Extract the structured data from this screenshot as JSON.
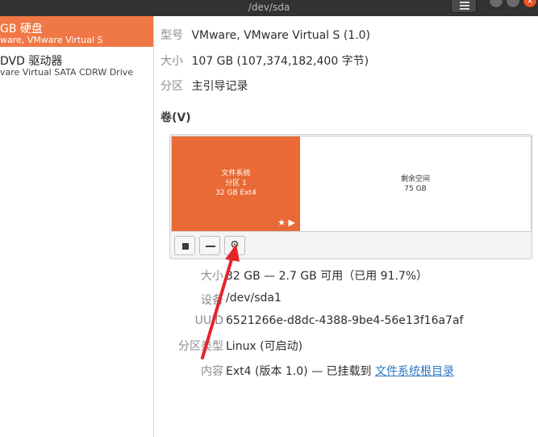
{
  "window": {
    "title": "/dev/sda",
    "menu_icon": "hamburger-menu-icon",
    "window_controls": [
      "minimize-icon",
      "maximize-icon",
      "close-icon"
    ],
    "close_glyph": "×"
  },
  "sidebar": {
    "items": [
      {
        "name": "GB 硬盘",
        "subtitle": "ware, VMware Virtual S",
        "selected": true
      },
      {
        "name": "DVD 驱动器",
        "subtitle": "vare Virtual SATA CDRW Drive",
        "selected": false
      }
    ]
  },
  "disk": {
    "model_label": "型号",
    "model_value": "VMware, VMware Virtual S (1.0)",
    "size_label": "大小",
    "size_value": "107 GB (107,374,182,400 字节)",
    "partition_label": "分区",
    "partition_value": "主引导记录"
  },
  "volumes": {
    "heading": "卷(V)",
    "partition": {
      "line1": "文件系统",
      "line2": "分区 1",
      "line3": "32 GB Ext4",
      "icons": "★ ▶"
    },
    "free": {
      "line1": "剩余空间",
      "line2": "75 GB"
    },
    "buttons": {
      "stop_icon": "stop-icon",
      "remove_icon": "minus-icon",
      "settings_icon": "gear-icon",
      "gear_glyph": "⚙"
    }
  },
  "details": {
    "size_label": "大小",
    "size_value": "32 GB — 2.7 GB 可用（已用 91.7%）",
    "device_label": "设备",
    "device_value": "/dev/sda1",
    "uuid_label": "UUID",
    "uuid_value": "6521266e-d8dc-4388-9be4-56e13f16a7af",
    "type_label": "分区类型",
    "type_value": "Linux (可启动)",
    "content_label": "内容",
    "content_value": "Ext4 (版本 1.0) — 已挂载到 ",
    "content_link": "文件系统根目录"
  },
  "colors": {
    "selected": "#f07746",
    "partition": "#e96a36",
    "arrow": "#e5252c",
    "link": "#2a76c6"
  }
}
